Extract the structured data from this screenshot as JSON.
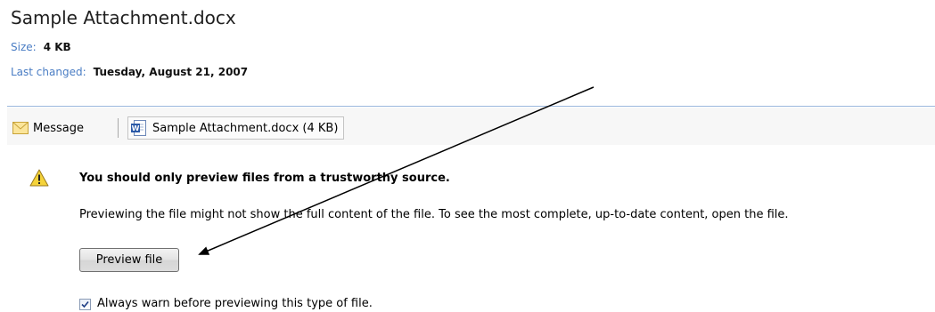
{
  "file": {
    "title": "Sample Attachment.docx",
    "size_label": "Size:",
    "size_value": "4 KB",
    "changed_label": "Last changed:",
    "changed_value": "Tuesday, August 21, 2007"
  },
  "tabs": {
    "message_label": "Message",
    "message_icon": "envelope-icon",
    "attachment_label": "Sample Attachment.docx (4 KB)",
    "attachment_icon": "word-document-icon"
  },
  "warning": {
    "icon": "warning-icon",
    "heading": "You should only preview files from a trustworthy source.",
    "body": "Previewing the file might not show the full content of the file. To see the most complete, up-to-date content, open the file.",
    "button_label": "Preview file",
    "checkbox_label": "Always warn before previewing this type of file.",
    "checkbox_checked": true
  },
  "colors": {
    "label_blue": "#4a7dc4",
    "rule_blue": "#9bb7dd",
    "warning_yellow": "#f5d33a"
  }
}
